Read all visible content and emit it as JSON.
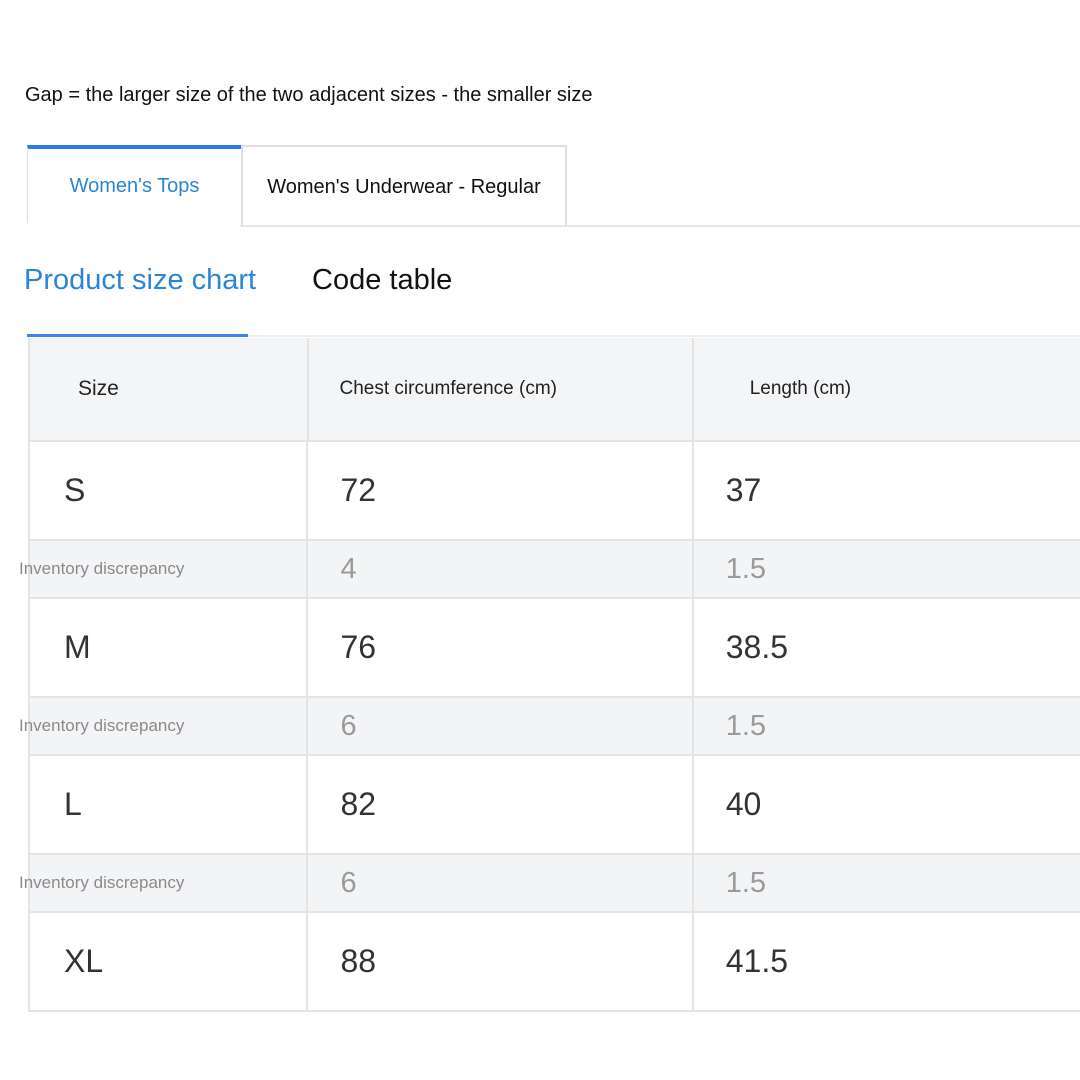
{
  "note": "Gap = the larger size of the two adjacent sizes - the smaller size",
  "category_tabs": [
    {
      "label": "Women's Tops",
      "active": true
    },
    {
      "label": "Women's Underwear - Regular",
      "active": false
    }
  ],
  "sub_tabs": [
    {
      "label": "Product size chart",
      "active": true
    },
    {
      "label": "Code table",
      "active": false
    }
  ],
  "table": {
    "headers": [
      "Size",
      "Chest circumference (cm)",
      "Length (cm)"
    ],
    "rows": [
      {
        "type": "size",
        "cells": [
          "S",
          "72",
          "37"
        ]
      },
      {
        "type": "gap",
        "cells": [
          "Inventory discrepancy",
          "4",
          "1.5"
        ]
      },
      {
        "type": "size",
        "cells": [
          "M",
          "76",
          "38.5"
        ]
      },
      {
        "type": "gap",
        "cells": [
          "Inventory discrepancy",
          "6",
          "1.5"
        ]
      },
      {
        "type": "size",
        "cells": [
          "L",
          "82",
          "40"
        ]
      },
      {
        "type": "gap",
        "cells": [
          "Inventory discrepancy",
          "6",
          "1.5"
        ]
      },
      {
        "type": "size",
        "cells": [
          "XL",
          "88",
          "41.5"
        ]
      }
    ]
  },
  "colors": {
    "accent": "#2a86d4",
    "tab_indicator": "#2f7ae8",
    "header_bg": "#f4f5f7",
    "gap_row_bg": "#f3f4f6"
  }
}
